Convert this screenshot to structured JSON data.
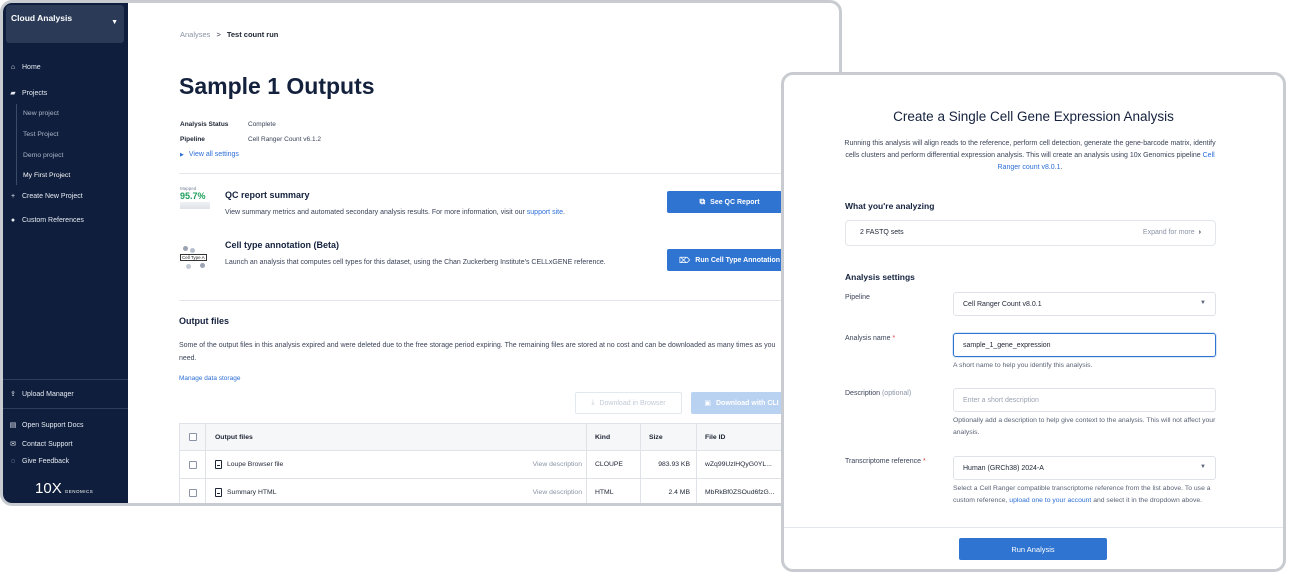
{
  "sidebar": {
    "org": "Cloud Analysis",
    "items": {
      "home": "Home",
      "projects": "Projects",
      "sub": [
        "New project",
        "Test Project",
        "Demo project",
        "My First Project"
      ],
      "create": "Create New Project",
      "refs": "Custom References",
      "upload": "Upload Manager",
      "docs": "Open Support Docs",
      "contact": "Contact Support",
      "feedback": "Give Feedback"
    },
    "brand_big": "10",
    "brand_x": "X",
    "brand_small": "GENOMICS"
  },
  "breadcrumb": {
    "parent": "Analyses",
    "sep": ">",
    "current": "Test count run"
  },
  "page": {
    "title": "Sample 1 Outputs",
    "status_label": "Analysis Status",
    "status_value": "Complete",
    "pipeline_label": "Pipeline",
    "pipeline_value": "Cell Ranger Count v6.1.2",
    "view_settings": "View all settings"
  },
  "qc": {
    "badge_label": "Mapped",
    "badge_value": "95.7%",
    "title": "QC report summary",
    "desc": "View summary metrics and automated secondary analysis results. For more information, visit our",
    "link": "support site",
    "button": "See QC Report"
  },
  "celltype": {
    "thumb_tag": "Cell Type A",
    "title": "Cell type annotation (Beta)",
    "desc": "Launch an analysis that computes cell types for this dataset, using the Chan Zuckerberg Institute's CELLxGENE reference.",
    "button": "Run Cell Type Annotation"
  },
  "outputs": {
    "heading": "Output files",
    "desc": "Some of the output files in this analysis expired and were deleted due to the free storage period expiring. The remaining files are stored at no cost and can be downloaded as many times as you need.",
    "manage": "Manage data storage",
    "btn_browser": "Download in Browser",
    "btn_cli": "Download with CLI",
    "columns": [
      "Output files",
      "Kind",
      "Size",
      "File ID"
    ],
    "rows": [
      {
        "name": "Loupe Browser file",
        "desc": "View description",
        "kind": "CLOUPE",
        "size": "983.93 KB",
        "id": "wZq99UzlHQyG0YL..."
      },
      {
        "name": "Summary HTML",
        "desc": "View description",
        "kind": "HTML",
        "size": "2.4 MB",
        "id": "MbRkBf0ZSOud6fzG..."
      }
    ]
  },
  "create": {
    "title": "Create a Single Cell Gene Expression Analysis",
    "intro": "Running this analysis will align reads to the reference, perform cell detection, generate the gene-barcode matrix, identify cells clusters and perform differential expression analysis. This will create an analysis using 10x Genomics pipeline",
    "intro_link": "Cell Ranger count v8.0.1",
    "intro_end": ".",
    "analyzing_heading": "What you're analyzing",
    "fastq": "2 FASTQ sets",
    "expand": "Expand for more",
    "settings_heading": "Analysis settings",
    "pipeline_label": "Pipeline",
    "pipeline_value": "Cell Ranger Count v8.0.1",
    "name_label": "Analysis name",
    "name_value": "sample_1_gene_expression",
    "name_help": "A short name to help you identify this analysis.",
    "desc_label": "Description",
    "desc_optional": "(optional)",
    "desc_placeholder": "Enter a short description",
    "desc_help": "Optionally add a description to help give context to the analysis. This will not affect your analysis.",
    "ref_label": "Transcriptome reference",
    "ref_value": "Human (GRCh38) 2024-A",
    "ref_help_start": "Select a Cell Ranger compatible transcriptome reference from the list above. To use a custom reference,",
    "ref_help_link": "upload one to your account",
    "ref_help_end": "and select it in the dropdown above.",
    "run": "Run Analysis",
    "required_mark": "*"
  },
  "colors": {
    "sidebar": "#0f1e3c",
    "accent": "#2f74d0",
    "success": "#1b9e5a"
  },
  "icons": [
    "house-icon",
    "folder-icon",
    "plus-icon",
    "reference-icon",
    "upload-icon",
    "docs-icon",
    "mail-icon",
    "feedback-icon",
    "external-link-icon",
    "tag-icon",
    "download-icon",
    "file-icon",
    "chevron-right-icon",
    "chevron-down-icon"
  ]
}
